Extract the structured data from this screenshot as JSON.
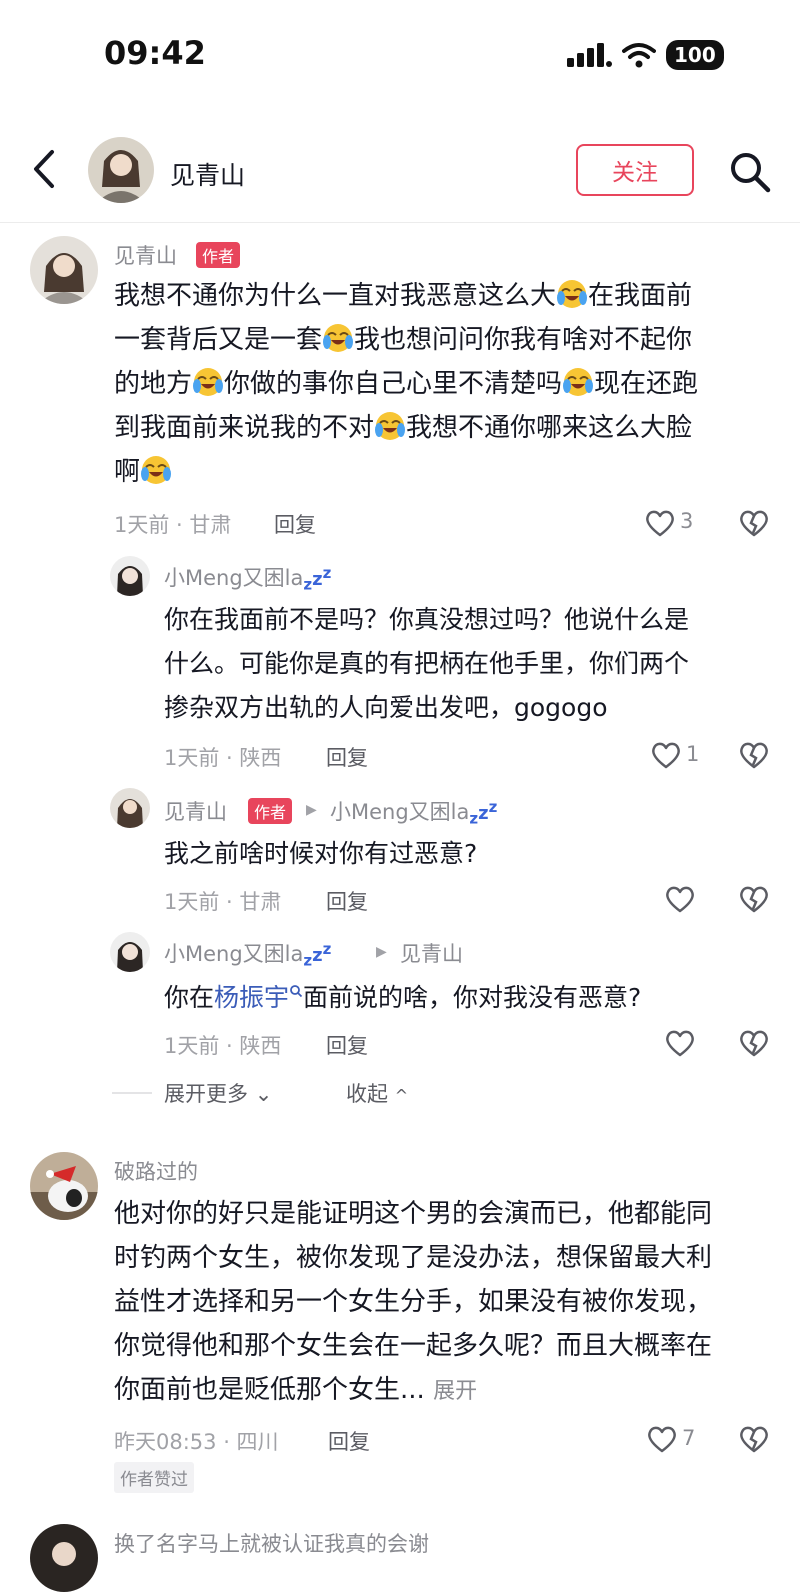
{
  "status": {
    "time": "09:42",
    "battery": "100"
  },
  "header": {
    "name": "见青山",
    "follow": "关注"
  },
  "comments": {
    "c1": {
      "name": "见青山",
      "badge": "作者",
      "lines": [
        "我想不通你为什么一直对我恶意这么大",
        "在我面前",
        "一套背后又是一套",
        "我也想问问你我有啥对不起你",
        "的地方",
        "你做的事你自己心里不清楚吗",
        "现在还跑",
        "到我面前来说我的不对",
        "我想不通你哪来这么大脸",
        "啊"
      ],
      "meta": "1天前 · 甘肃",
      "reply": "回复",
      "likes": "3"
    },
    "r1": {
      "name": "小Meng又困la",
      "lines": [
        "你在我面前不是吗？你真没想过吗？他说什么是",
        "什么。可能你是真的有把柄在他手里，你们两个",
        "掺杂双方出轨的人向爱出发吧，gogogo"
      ],
      "meta": "1天前 · 陕西",
      "reply": "回复",
      "likes": "1"
    },
    "r2": {
      "name": "见青山",
      "badge": "作者",
      "to": "小Meng又困la",
      "text": "我之前啥时候对你有过恶意?",
      "meta": "1天前 · 甘肃",
      "reply": "回复"
    },
    "r3": {
      "name": "小Meng又困la",
      "to": "见青山",
      "pre": "你在",
      "link": "杨振宇",
      "post": "面前说的啥，你对我没有恶意?",
      "meta": "1天前 · 陕西",
      "reply": "回复"
    },
    "expand": "展开更多",
    "collapse": "收起",
    "c2": {
      "name": "破路过的",
      "lines": [
        "他对你的好只是能证明这个男的会演而已，他都能同",
        "时钓两个女生，被你发现了是没办法，想保留最大利",
        "益性才选择和另一个女生分手，如果没有被你发现，",
        "你觉得他和那个女生会在一起多久呢？而且大概率在",
        "你面前也是贬低那个女生..."
      ],
      "more": "展开",
      "meta": "昨天08:53 · 四川",
      "reply": "回复",
      "likes": "7",
      "tag": "作者赞过"
    },
    "c3": {
      "name": "换了名字马上就被认证我真的会谢"
    }
  },
  "colors": {
    "accent": "#e8455c",
    "link": "#3b5cb8"
  }
}
